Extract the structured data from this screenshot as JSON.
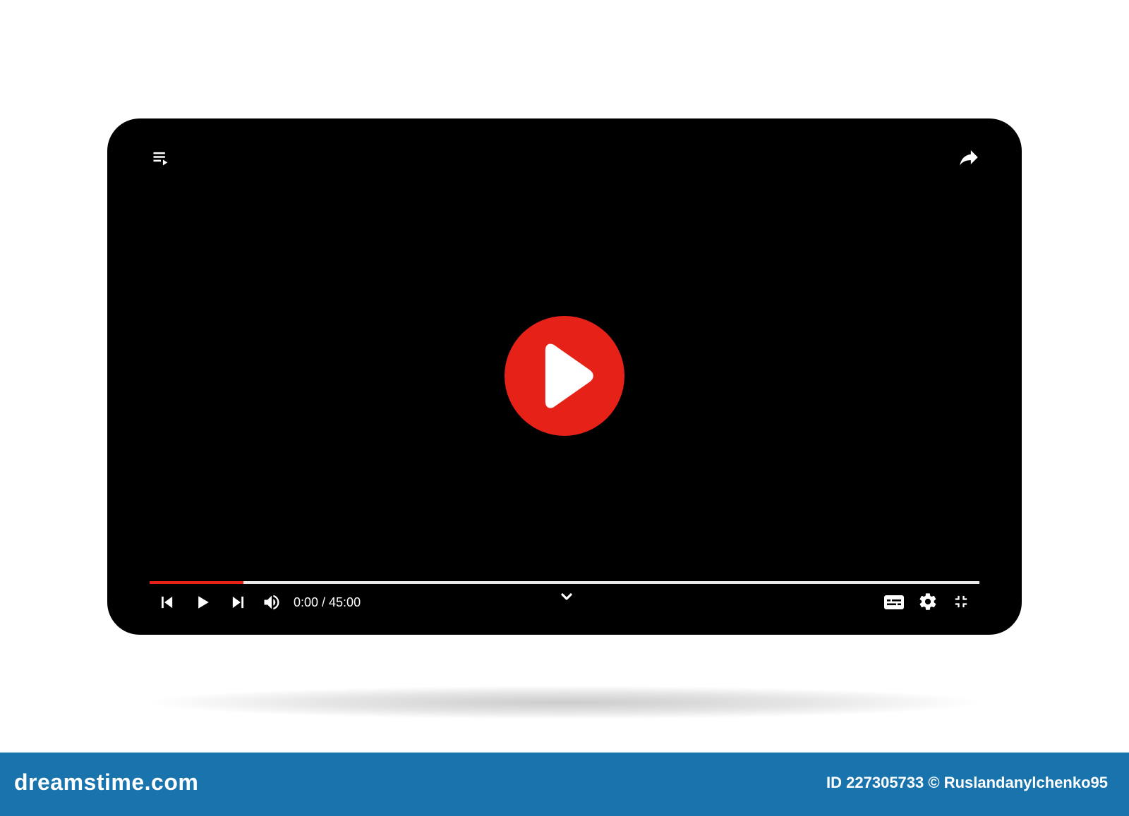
{
  "player": {
    "time_display": "0:00 / 45:00",
    "progress_fraction": 0.113,
    "accent_color": "#e62117",
    "background_color": "#000000",
    "icons": {
      "top_left": "playlist-icon",
      "top_right": "share-icon",
      "center": "play-icon",
      "controls": [
        "skip-previous-icon",
        "play-icon",
        "skip-next-icon",
        "volume-icon",
        "chevron-down-icon",
        "subtitles-icon",
        "settings-icon",
        "exit-fullscreen-icon"
      ]
    }
  },
  "footer": {
    "brand": "dreamstime.com",
    "credit": "ID 227305733 © Ruslandanylchenko95",
    "color": "#1974ae"
  }
}
